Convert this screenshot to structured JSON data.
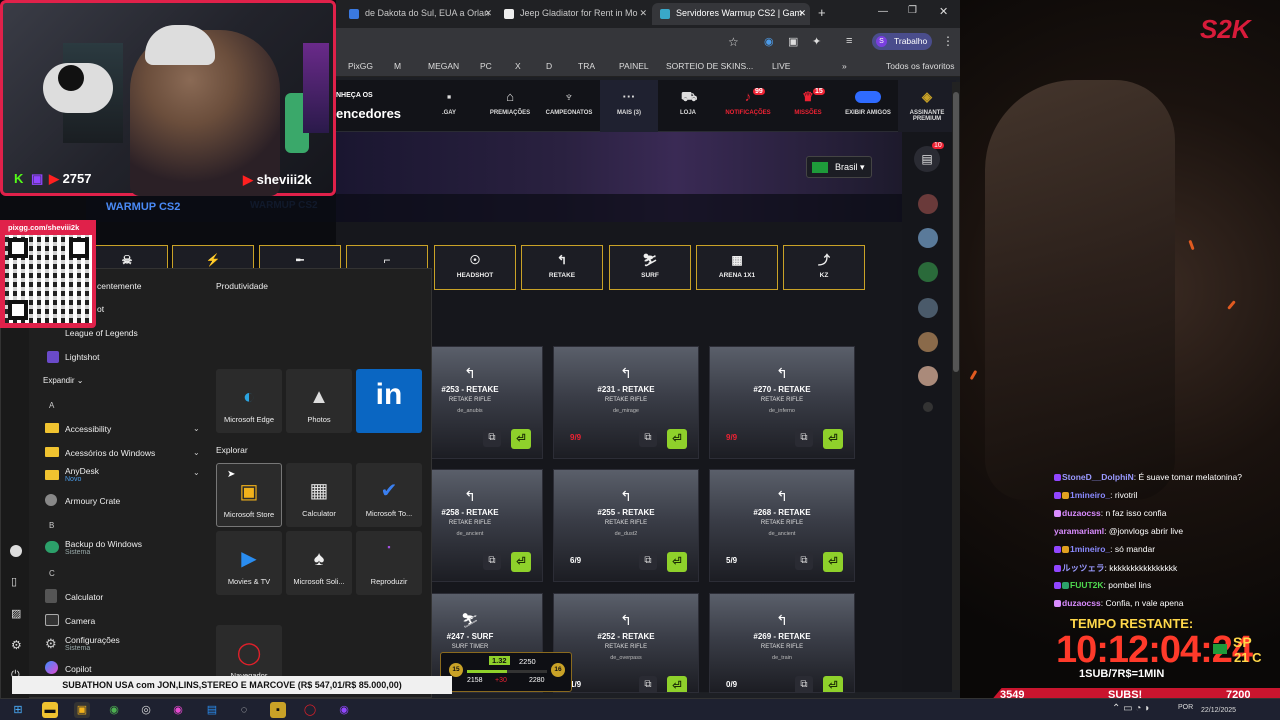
{
  "stream_overlay": {
    "logo": "S2K",
    "viewer_count": "2757",
    "streamer": "sheviii2k",
    "qr_url": "pixgg.com/sheviii2k",
    "subathon_banner": "SUBATHON USA com JON,LINS,STEREO E MARCOVE (R$ 547,01/R$ 85.000,00)",
    "timer_label": "TEMPO RESTANTE:",
    "timer": "10:12:04:24",
    "region": "SP",
    "temperature": "21 C",
    "sub_rule": "1SUB/7R$=1MIN",
    "subs_left": "3549",
    "subs_label": "SUBS!",
    "subs_right": "7200"
  },
  "browser": {
    "tabs": [
      {
        "label": "de Dakota do Sul, EUA a Orlan",
        "active": false
      },
      {
        "label": "Jeep Gladiator for Rent in Mo",
        "active": false
      },
      {
        "label": "Servidores Warmup CS2 | Gam",
        "active": true
      }
    ],
    "profile_label": "Trabalho",
    "bookmarks": [
      "PixGG",
      "M",
      "MEGAN",
      "PC",
      "X",
      "D",
      "TRA",
      "PAINEL",
      "SORTEIO DE SKINS...",
      "LIVE"
    ],
    "all_favorites": "Todos os favoritos"
  },
  "site": {
    "promo_top": "NHEÇA OS",
    "promo_bottom": "encedores",
    "nav": [
      {
        "label": ".GAY",
        "icon": "chat-icon"
      },
      {
        "label": "PREMIAÇÕES",
        "icon": "prize-icon"
      },
      {
        "label": "CAMPEONATOS",
        "icon": "trophy-icon"
      },
      {
        "label": "MAIS (3)",
        "icon": "more-icon"
      },
      {
        "label": "LOJA",
        "icon": "cart-icon"
      },
      {
        "label": "NOTIFICAÇÕES",
        "icon": "bell-icon",
        "badge": "99"
      },
      {
        "label": "MISSÕES",
        "icon": "mission-icon",
        "badge": "15"
      },
      {
        "label": "EXIBIR AMIGOS",
        "icon": "toggle-icon"
      },
      {
        "label": "ASSINANTE PREMIUM",
        "icon": "premium-icon"
      }
    ],
    "language": "Brasil",
    "section_title": "WARMUP CS2",
    "chat_badge": "10",
    "modes": [
      "",
      "",
      "",
      "",
      "HEADSHOT",
      "RETAKE",
      "SURF",
      "ARENA 1X1",
      "KZ"
    ],
    "servers": [
      {
        "title": "#253 - RETAKE",
        "sub": "RETAKE RIFLE",
        "map": "de_anubis",
        "players": "",
        "full": false
      },
      {
        "title": "#231 - RETAKE",
        "sub": "RETAKE RIFLE",
        "map": "de_mirage",
        "players": "9/9",
        "full": true
      },
      {
        "title": "#270 - RETAKE",
        "sub": "RETAKE RIFLE",
        "map": "de_inferno",
        "players": "9/9",
        "full": true
      },
      {
        "title": "#258 - RETAKE",
        "sub": "RETAKE RIFLE",
        "map": "de_ancient",
        "players": "",
        "full": false
      },
      {
        "title": "#255 - RETAKE",
        "sub": "RETAKE RIFLE",
        "map": "de_dust2",
        "players": "6/9",
        "full": false
      },
      {
        "title": "#268 - RETAKE",
        "sub": "RETAKE RIFLE",
        "map": "de_ancient",
        "players": "5/9",
        "full": false
      },
      {
        "title": "#247 - SURF",
        "sub": "SURF TIMER",
        "map": "",
        "players": "",
        "full": false
      },
      {
        "title": "#252 - RETAKE",
        "sub": "RETAKE RIFLE",
        "map": "de_overpass",
        "players": "1/9",
        "full": false
      },
      {
        "title": "#269 - RETAKE",
        "sub": "RETAKE RIFLE",
        "map": "de_train",
        "players": "0/9",
        "full": false
      }
    ],
    "stats": {
      "level": "15",
      "elo": "1.32",
      "points": "2250",
      "p_left": "2158",
      "p_delta": "+30",
      "p_right": "2280",
      "level_next": "16"
    }
  },
  "start_menu": {
    "recent_label": "centemente",
    "recent": [
      "ot",
      "League of Legends",
      "Lightshot"
    ],
    "expand": "Expandir",
    "letters": [
      "A",
      "B",
      "C"
    ],
    "apps": [
      {
        "label": "Accessibility",
        "sub": ""
      },
      {
        "label": "Acessórios do Windows",
        "sub": ""
      },
      {
        "label": "AnyDesk",
        "sub": "Novo"
      },
      {
        "label": "Armoury Crate",
        "sub": ""
      },
      {
        "label": "Backup do Windows",
        "sub": "Sistema"
      },
      {
        "label": "Calculator",
        "sub": ""
      },
      {
        "label": "Camera",
        "sub": ""
      },
      {
        "label": "Configurações",
        "sub": "Sistema"
      },
      {
        "label": "Copilot",
        "sub": ""
      }
    ],
    "group_productivity": "Produtividade",
    "group_explore": "Explorar",
    "tiles": [
      {
        "label": "Microsoft Edge",
        "icon": "edge-icon"
      },
      {
        "label": "Photos",
        "icon": "photos-icon"
      },
      {
        "label": "",
        "icon": "linkedin-icon"
      },
      {
        "label": "Microsoft Store",
        "icon": "store-icon"
      },
      {
        "label": "Calculator",
        "icon": "calculator-icon"
      },
      {
        "label": "Microsoft To...",
        "icon": "todo-icon"
      },
      {
        "label": "Movies & TV",
        "icon": "movies-icon"
      },
      {
        "label": "Microsoft Soli...",
        "icon": "solitaire-icon"
      },
      {
        "label": "Reproduzir",
        "icon": "play-icon"
      },
      {
        "label": "Navegador",
        "icon": "opera-icon"
      }
    ]
  },
  "chat": [
    {
      "user": "StoneD__DolphiN",
      "msg": ": É suave tomar melatonina?",
      "color": "#9a9aff"
    },
    {
      "user": "1mineiro_",
      "msg": ": rivotril",
      "color": "#8a8aff"
    },
    {
      "user": "duzaocss",
      "msg": ": n faz isso confia",
      "color": "#d98cff"
    },
    {
      "user": "yaramariaml",
      "msg": ": @jonvlogs abrir live",
      "color": "#d98cff"
    },
    {
      "user": "1mineiro_",
      "msg": ": só mandar",
      "color": "#8a8aff"
    },
    {
      "user": "ルッツェラ",
      "msg": ": kkkkkkkkkkkkkkkk",
      "color": "#9a9aff"
    },
    {
      "user": "FUUT2K",
      "msg": ": pombel lins",
      "color": "#4fd84f"
    },
    {
      "user": "duzaocss",
      "msg": ": Confia, n vale apena",
      "color": "#d98cff"
    }
  ],
  "taskbar": {
    "lang": "POR",
    "date": "22/12/2025"
  }
}
